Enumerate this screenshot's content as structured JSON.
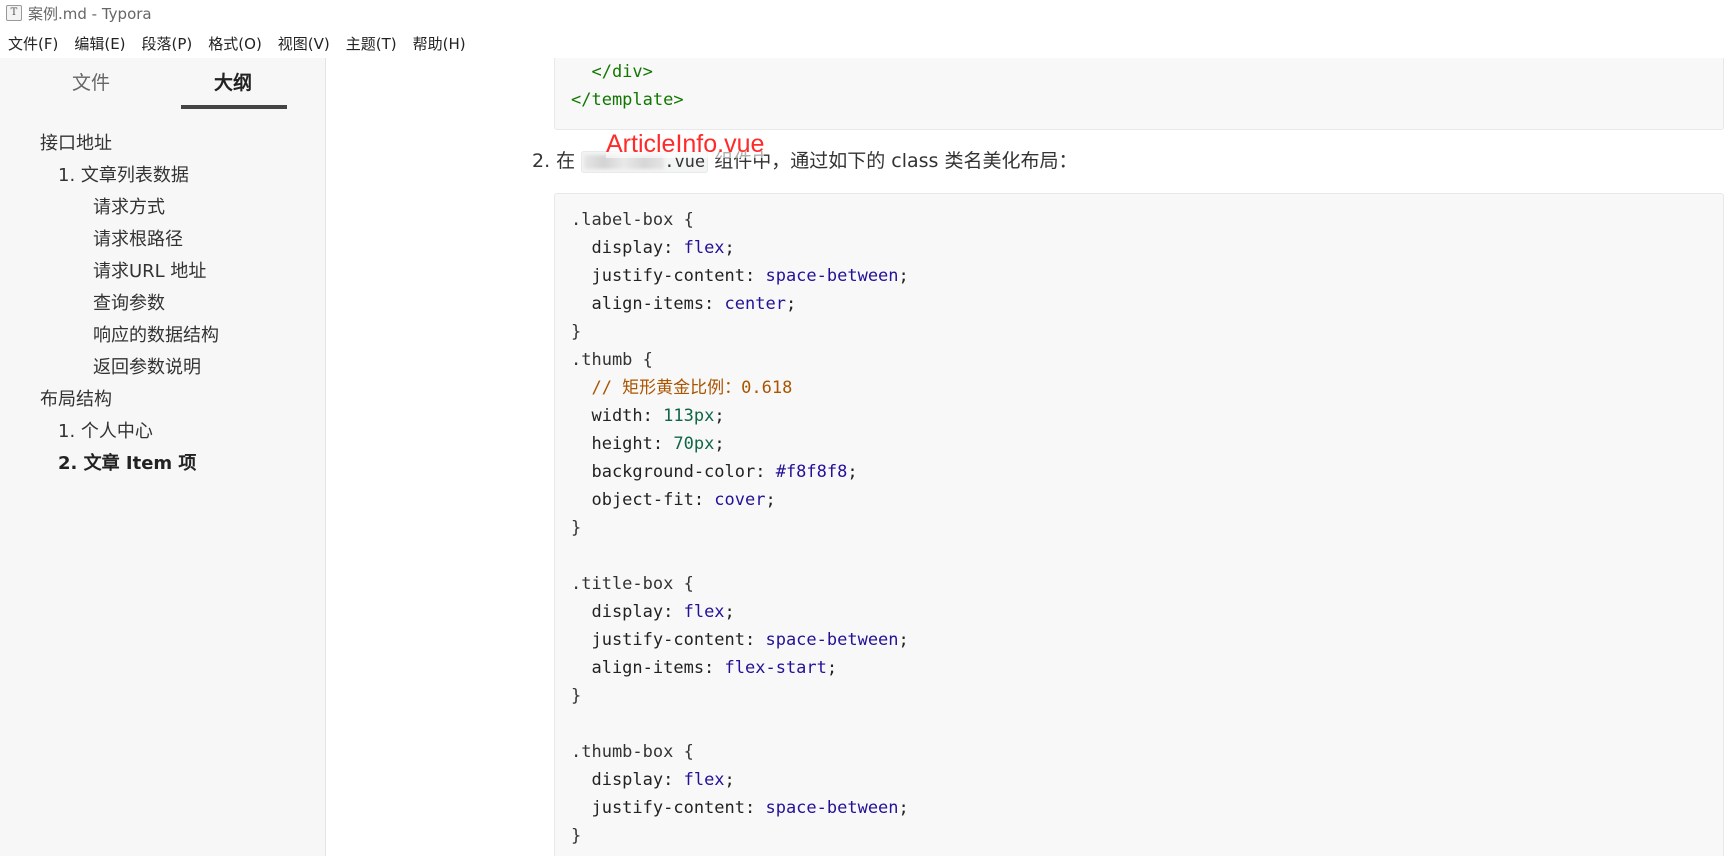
{
  "window": {
    "title": "案例.md - Typora",
    "app_icon": "T"
  },
  "menubar": {
    "items": [
      "文件(F)",
      "编辑(E)",
      "段落(P)",
      "格式(O)",
      "视图(V)",
      "主题(T)",
      "帮助(H)"
    ]
  },
  "sidebar": {
    "tabs": {
      "files": "文件",
      "outline": "大纲",
      "active": "outline"
    },
    "outline": [
      {
        "label": "接口地址",
        "level": 1,
        "active": false
      },
      {
        "label": "1. 文章列表数据",
        "level": 2,
        "active": false
      },
      {
        "label": "请求方式",
        "level": 3,
        "active": false
      },
      {
        "label": "请求根路径",
        "level": 3,
        "active": false
      },
      {
        "label": "请求URL 地址",
        "level": 3,
        "active": false
      },
      {
        "label": "查询参数",
        "level": 3,
        "active": false
      },
      {
        "label": "响应的数据结构",
        "level": 3,
        "active": false
      },
      {
        "label": "返回参数说明",
        "level": 3,
        "active": false
      },
      {
        "label": "布局结构",
        "level": 1,
        "active": false
      },
      {
        "label": "1. 个人中心",
        "level": 2,
        "active": false
      },
      {
        "label": "2. 文章 Item 项",
        "level": 2,
        "active": true
      }
    ]
  },
  "editor": {
    "top_code": {
      "lines": [
        "  </div>",
        "</template>"
      ]
    },
    "list_item": {
      "number": "2.",
      "prefix": "在",
      "code_suffix": ".vue",
      "suffix": "组件中，通过如下的 class 类名美化布局："
    },
    "annotation": "ArticleInfo.vue",
    "css_code": [
      [
        {
          "t": "sel",
          "v": ".label-box {"
        }
      ],
      [
        {
          "t": "prop",
          "v": "  display: "
        },
        {
          "t": "val",
          "v": "flex"
        },
        {
          "t": "prop",
          "v": ";"
        }
      ],
      [
        {
          "t": "prop",
          "v": "  justify-content: "
        },
        {
          "t": "val",
          "v": "space-between"
        },
        {
          "t": "prop",
          "v": ";"
        }
      ],
      [
        {
          "t": "prop",
          "v": "  align-items: "
        },
        {
          "t": "val",
          "v": "center"
        },
        {
          "t": "prop",
          "v": ";"
        }
      ],
      [
        {
          "t": "sel",
          "v": "}"
        }
      ],
      [
        {
          "t": "sel",
          "v": ".thumb {"
        }
      ],
      [
        {
          "t": "comment",
          "v": "  // 矩形黄金比例：0.618"
        }
      ],
      [
        {
          "t": "prop",
          "v": "  width: "
        },
        {
          "t": "num",
          "v": "113px"
        },
        {
          "t": "prop",
          "v": ";"
        }
      ],
      [
        {
          "t": "prop",
          "v": "  height: "
        },
        {
          "t": "num",
          "v": "70px"
        },
        {
          "t": "prop",
          "v": ";"
        }
      ],
      [
        {
          "t": "prop",
          "v": "  background-color: "
        },
        {
          "t": "hex",
          "v": "#f8f8f8"
        },
        {
          "t": "prop",
          "v": ";"
        }
      ],
      [
        {
          "t": "prop",
          "v": "  object-fit: "
        },
        {
          "t": "val",
          "v": "cover"
        },
        {
          "t": "prop",
          "v": ";"
        }
      ],
      [
        {
          "t": "sel",
          "v": "}"
        }
      ],
      [
        {
          "t": "sel",
          "v": ""
        }
      ],
      [
        {
          "t": "sel",
          "v": ".title-box {"
        }
      ],
      [
        {
          "t": "prop",
          "v": "  display: "
        },
        {
          "t": "val",
          "v": "flex"
        },
        {
          "t": "prop",
          "v": ";"
        }
      ],
      [
        {
          "t": "prop",
          "v": "  justify-content: "
        },
        {
          "t": "val",
          "v": "space-between"
        },
        {
          "t": "prop",
          "v": ";"
        }
      ],
      [
        {
          "t": "prop",
          "v": "  align-items: "
        },
        {
          "t": "val",
          "v": "flex-start"
        },
        {
          "t": "prop",
          "v": ";"
        }
      ],
      [
        {
          "t": "sel",
          "v": "}"
        }
      ],
      [
        {
          "t": "sel",
          "v": ""
        }
      ],
      [
        {
          "t": "sel",
          "v": ".thumb-box {"
        }
      ],
      [
        {
          "t": "prop",
          "v": "  display: "
        },
        {
          "t": "val",
          "v": "flex"
        },
        {
          "t": "prop",
          "v": ";"
        }
      ],
      [
        {
          "t": "prop",
          "v": "  justify-content: "
        },
        {
          "t": "val",
          "v": "space-between"
        },
        {
          "t": "prop",
          "v": ";"
        }
      ],
      [
        {
          "t": "sel",
          "v": "}"
        }
      ]
    ]
  },
  "colors": {
    "annotation": "#ff2a2a",
    "sidebar_bg": "#f7f7f7",
    "code_bg": "#f8f8f8",
    "css_value": "#221199",
    "css_number": "#116644",
    "comment": "#aa5500",
    "tag": "#117700"
  }
}
